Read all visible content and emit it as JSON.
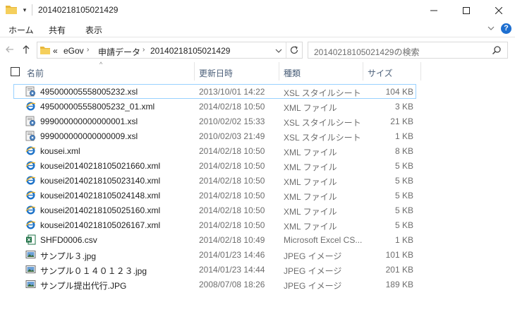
{
  "window": {
    "title": "20140218105021429",
    "pin_glyph": "▾",
    "min_glyph": "—",
    "max_glyph": "☐",
    "close_glyph": "✕"
  },
  "ribbon": {
    "tabs": [
      "ホーム",
      "共有",
      "表示"
    ],
    "collapse_glyph": "⌵",
    "help_glyph": "?"
  },
  "address": {
    "overflow": "«",
    "segments": [
      "eGov",
      "申請データ",
      "20140218105021429"
    ],
    "separator": "›",
    "dropdown_glyph": "⌵",
    "refresh_glyph": "↻",
    "back_glyph": "←",
    "forward_glyph": "→",
    "up_glyph": "↑"
  },
  "search": {
    "placeholder": "20140218105021429の検索"
  },
  "columns": {
    "name": "名前",
    "date": "更新日時",
    "type": "種類",
    "size": "サイズ",
    "sort_glyph": "^"
  },
  "files": [
    {
      "name": "495000005558005232.xsl",
      "date": "2013/10/01 14:22",
      "type": "XSL スタイルシート",
      "size": "104 KB",
      "icon": "xsl-icon",
      "selected": true
    },
    {
      "name": "495000005558005232_01.xml",
      "date": "2014/02/18 10:50",
      "type": "XML ファイル",
      "size": "3 KB",
      "icon": "xml-icon"
    },
    {
      "name": "999000000000000001.xsl",
      "date": "2010/02/02 15:33",
      "type": "XSL スタイルシート",
      "size": "21 KB",
      "icon": "xsl-icon"
    },
    {
      "name": "999000000000000009.xsl",
      "date": "2010/02/03 21:49",
      "type": "XSL スタイルシート",
      "size": "1 KB",
      "icon": "xsl-icon"
    },
    {
      "name": "kousei.xml",
      "date": "2014/02/18 10:50",
      "type": "XML ファイル",
      "size": "8 KB",
      "icon": "xml-icon"
    },
    {
      "name": "kousei20140218105021660.xml",
      "date": "2014/02/18 10:50",
      "type": "XML ファイル",
      "size": "5 KB",
      "icon": "xml-icon"
    },
    {
      "name": "kousei20140218105023140.xml",
      "date": "2014/02/18 10:50",
      "type": "XML ファイル",
      "size": "5 KB",
      "icon": "xml-icon"
    },
    {
      "name": "kousei20140218105024148.xml",
      "date": "2014/02/18 10:50",
      "type": "XML ファイル",
      "size": "5 KB",
      "icon": "xml-icon"
    },
    {
      "name": "kousei20140218105025160.xml",
      "date": "2014/02/18 10:50",
      "type": "XML ファイル",
      "size": "5 KB",
      "icon": "xml-icon"
    },
    {
      "name": "kousei20140218105026167.xml",
      "date": "2014/02/18 10:50",
      "type": "XML ファイル",
      "size": "5 KB",
      "icon": "xml-icon"
    },
    {
      "name": "SHFD0006.csv",
      "date": "2014/02/18 10:49",
      "type": "Microsoft Excel CS...",
      "size": "1 KB",
      "icon": "excel-csv-icon"
    },
    {
      "name": "サンプル３.jpg",
      "date": "2014/01/23 14:46",
      "type": "JPEG イメージ",
      "size": "101 KB",
      "icon": "jpeg-image-icon"
    },
    {
      "name": "サンプル０１４０１２３.jpg",
      "date": "2014/01/23 14:44",
      "type": "JPEG イメージ",
      "size": "201 KB",
      "icon": "jpeg-image-icon"
    },
    {
      "name": "サンプル提出代行.JPG",
      "date": "2008/07/08 18:26",
      "type": "JPEG イメージ",
      "size": "189 KB",
      "icon": "jpeg-image-icon"
    }
  ],
  "colors": {
    "selection_border": "#99d1ff",
    "folder_yellow": "#e8b73a",
    "ie_blue": "#1e73c8",
    "excel_green": "#1e7145",
    "help_blue": "#1e6fd0",
    "header_text": "#4c607a"
  }
}
